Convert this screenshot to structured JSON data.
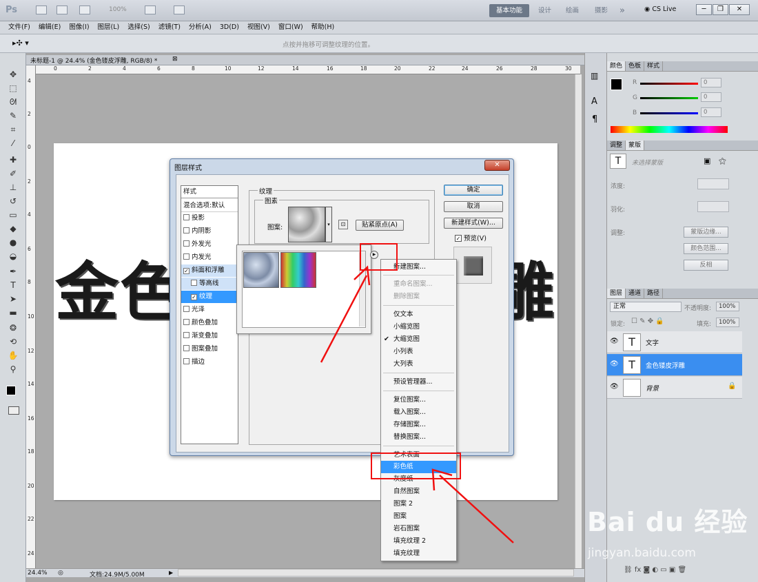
{
  "app": {
    "logo": "Ps",
    "zoom": "100%",
    "workspaces": [
      "基本功能",
      "设计",
      "绘画",
      "摄影"
    ],
    "more": "»",
    "cs_live": "CS Live",
    "win_buttons": [
      "─",
      "❐",
      "✕"
    ]
  },
  "menu": [
    "文件(F)",
    "编辑(E)",
    "图像(I)",
    "图层(L)",
    "选择(S)",
    "滤镜(T)",
    "分析(A)",
    "3D(D)",
    "视图(V)",
    "窗口(W)",
    "帮助(H)"
  ],
  "options_hint": "点按并拖移可调整纹理的位置。",
  "document": {
    "tab_title": "未标题-1 @ 24.4% (金色镂皮浮雕, RGB/8) *",
    "ruler_top": [
      "0",
      "2",
      "4",
      "6",
      "8",
      "10",
      "12",
      "14",
      "16",
      "18",
      "20",
      "22",
      "24",
      "26",
      "28",
      "30"
    ],
    "ruler_left": [
      "4",
      "2",
      "0",
      "2",
      "4",
      "6",
      "8",
      "10",
      "12",
      "14",
      "16",
      "18",
      "20",
      "22",
      "24"
    ],
    "text_left": "金色",
    "text_right": "雕"
  },
  "status": {
    "zoom": "24.4%",
    "doc": "文档:24.9M/5.00M"
  },
  "color_panel": {
    "tabs": [
      "颜色",
      "色板",
      "样式"
    ],
    "channels": [
      {
        "label": "R",
        "value": "0"
      },
      {
        "label": "G",
        "value": "0"
      },
      {
        "label": "B",
        "value": "0"
      }
    ]
  },
  "adjust_panel": {
    "tabs": [
      "调整",
      "蒙版"
    ],
    "title": "未选择蒙版",
    "density": "浓度:",
    "feather": "羽化:",
    "refine": "调整:",
    "buttons": [
      "蒙版边缘...",
      "颜色范围...",
      "反相"
    ]
  },
  "layers_panel": {
    "tabs": [
      "图层",
      "通道",
      "路径"
    ],
    "blend": "正常",
    "opacity_label": "不透明度:",
    "opacity": "100%",
    "lock_label": "锁定:",
    "fill_label": "填充:",
    "fill": "100%",
    "layers": [
      {
        "name": "文字",
        "thumb": "T",
        "selected": false
      },
      {
        "name": "金色镂皮浮雕",
        "thumb": "T",
        "selected": true
      },
      {
        "name": "背景",
        "thumb": "",
        "selected": false
      }
    ]
  },
  "dialog": {
    "title": "图层样式",
    "close": "✕",
    "styles_header": "样式",
    "blend_default": "混合选项:默认",
    "style_items": [
      {
        "label": "投影",
        "checked": false
      },
      {
        "label": "内阴影",
        "checked": false
      },
      {
        "label": "外发光",
        "checked": false
      },
      {
        "label": "内发光",
        "checked": false
      },
      {
        "label": "斜面和浮雕",
        "checked": true
      },
      {
        "label": "等高线",
        "checked": false
      },
      {
        "label": "纹理",
        "checked": true
      },
      {
        "label": "光泽",
        "checked": false
      },
      {
        "label": "颜色叠加",
        "checked": false
      },
      {
        "label": "渐变叠加",
        "checked": false
      },
      {
        "label": "图案叠加",
        "checked": false
      },
      {
        "label": "描边",
        "checked": false
      }
    ],
    "texture_group": "纹理",
    "pattern_group": "图素",
    "pattern_label": "图案:",
    "snap_origin": "贴紧原点(A)",
    "ok": "确定",
    "cancel": "取消",
    "new_style": "新建样式(W)...",
    "preview": "预览(V)"
  },
  "menu_popup": {
    "items": [
      {
        "label": "新建图案...",
        "disabled": false
      },
      {
        "sep": true
      },
      {
        "label": "重命名图案...",
        "disabled": true
      },
      {
        "label": "删除图案",
        "disabled": true
      },
      {
        "sep": true
      },
      {
        "label": "仅文本",
        "disabled": false
      },
      {
        "label": "小缩览图",
        "disabled": false
      },
      {
        "label": "大缩览图",
        "disabled": false,
        "checked": true
      },
      {
        "label": "小列表",
        "disabled": false
      },
      {
        "label": "大列表",
        "disabled": false
      },
      {
        "sep": true
      },
      {
        "label": "预设管理器...",
        "disabled": false
      },
      {
        "sep": true
      },
      {
        "label": "复位图案...",
        "disabled": false
      },
      {
        "label": "载入图案...",
        "disabled": false
      },
      {
        "label": "存储图案...",
        "disabled": false
      },
      {
        "label": "替换图案...",
        "disabled": false
      },
      {
        "sep": true
      },
      {
        "label": "艺术表面",
        "disabled": false
      },
      {
        "label": "彩色纸",
        "disabled": false,
        "highlight": true
      },
      {
        "label": "灰度纸",
        "disabled": false
      },
      {
        "label": "自然图案",
        "disabled": false
      },
      {
        "label": "图案 2",
        "disabled": false
      },
      {
        "label": "图案",
        "disabled": false
      },
      {
        "label": "岩石图案",
        "disabled": false
      },
      {
        "label": "填充纹理 2",
        "disabled": false
      },
      {
        "label": "填充纹理",
        "disabled": false
      }
    ]
  },
  "watermark": {
    "brand": "Bai du 经验",
    "url": "jingyan.baidu.com"
  }
}
